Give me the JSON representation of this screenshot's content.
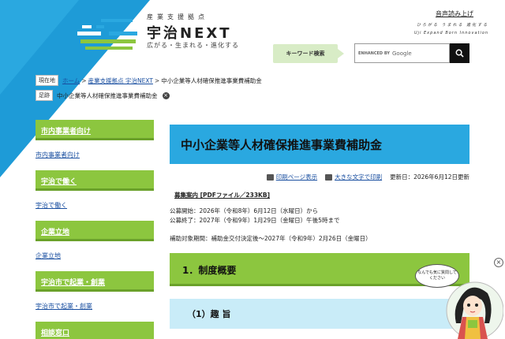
{
  "header": {
    "brand_sub": "産業支援拠点",
    "brand_title": "宇治NEXT",
    "brand_tagline": "広がる・生まれる・進化する",
    "read_aloud": "音声読み上げ",
    "hand_jp": "ひろがる うまれる 進化する",
    "hand_en": "Uji Expand Born Innovation",
    "keyword_search": "キーワード検索",
    "search_brand": "ENHANCED BY",
    "search_google": "Google"
  },
  "breadcrumb": {
    "label": "現在地",
    "items": [
      "ホーム",
      "産業支援拠点 宇治NEXT"
    ],
    "current": "中小企業等人材確保推進事業費補助金"
  },
  "footprint": {
    "label": "足跡",
    "item": "中小企業等人材確保推進事業費補助金",
    "remove": "×"
  },
  "sidebar": {
    "items": [
      {
        "button": "市内事業者向け",
        "link": "市内事業者向け"
      },
      {
        "button": "宇治で働く",
        "link": "宇治で働く"
      },
      {
        "button": "企業立地",
        "link": "企業立地"
      },
      {
        "button": "宇治市で起業・創業",
        "link": "宇治市で起業・創業"
      },
      {
        "button": "相談窓口",
        "link": ""
      }
    ]
  },
  "main": {
    "title": "中小企業等人材確保推進事業費補助金",
    "print_page": "印刷ページ表示",
    "large_print": "大きな文字で印刷",
    "updated": "更新日：2026年6月12日更新",
    "recruit_link": "募集案内 [PDFファイル／233KB]",
    "open_start": "公募開始：2026年（令和8年）6月12日（水曜日）から",
    "open_end": "公募終了：2027年（令和9年）1月29日（金曜日）午後5時まで",
    "period": "補助対象期間：補助金交付決定後～2027年（令和9年）2月26日（金曜日）",
    "h2": "1．制度概要",
    "h3": "（1）趣 旨"
  },
  "assistant": {
    "close": "×",
    "bubble": "なんでも気に質問してください"
  },
  "colors": {
    "blue": "#2aa8e0",
    "green": "#8cc63f",
    "light_blue": "#c9ecf8"
  }
}
